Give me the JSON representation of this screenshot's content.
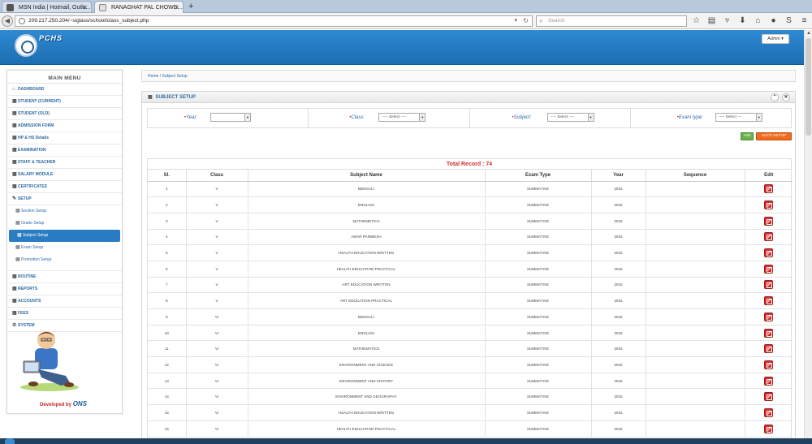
{
  "browser": {
    "tabs": [
      {
        "title": "MSN India | Hotmail, Outlo..."
      },
      {
        "title": "RANAGHAT PAL CHOWD..."
      }
    ],
    "new_tab": "+",
    "url": "209.217.250.204/~siglass/school/class_subject.php",
    "search_placeholder": "Search"
  },
  "app": {
    "logo_text": "PCHS",
    "admin_label": "Admin ▾"
  },
  "sidebar": {
    "title": "MAIN MENU",
    "items_top": [
      {
        "label": "DASHBOARD",
        "icon": "home-icon"
      },
      {
        "label": "STUDENT (CURRENT)",
        "icon": "grid-icon"
      },
      {
        "label": "STUDENT (OLD)",
        "icon": "grid-icon"
      },
      {
        "label": "ADMISSION FORM",
        "icon": "grid-icon"
      },
      {
        "label": "HP & HS Details",
        "icon": "grid-icon"
      },
      {
        "label": "EXAMINATION",
        "icon": "grid-icon"
      },
      {
        "label": "STAFF & TEACHER",
        "icon": "grid-icon"
      },
      {
        "label": "SALARY MODULE",
        "icon": "grid-icon"
      },
      {
        "label": "CERTIFICATES",
        "icon": "grid-icon"
      },
      {
        "label": "SETUP",
        "icon": "wrench-icon"
      }
    ],
    "sub_items": [
      {
        "label": "Section Setup"
      },
      {
        "label": "Grade Setup"
      },
      {
        "label": "Subject Setup"
      },
      {
        "label": "Exam Setup"
      },
      {
        "label": "Promotion Setup"
      }
    ],
    "items_bottom": [
      {
        "label": "ROUTINE",
        "icon": "grid-icon"
      },
      {
        "label": "REPORTS",
        "icon": "grid-icon"
      },
      {
        "label": "ACCOUNTS",
        "icon": "grid-icon"
      },
      {
        "label": "FEES",
        "icon": "grid-icon"
      },
      {
        "label": "SYSTEM",
        "icon": "gears-icon"
      }
    ],
    "developed_by": "Developed by",
    "developer": "ONS"
  },
  "breadcrumb": {
    "home": "Home",
    "sep": "/",
    "current": "Subject Setup"
  },
  "panel": {
    "title": "SUBJECT SETUP",
    "filters": {
      "year_label": "Year:",
      "year_value": "",
      "class_label": "Class:",
      "class_value": "---- Select ----",
      "subject_label": "Subject:",
      "subject_value": "---- Select ----",
      "exam_label": "Exam type:",
      "exam_value": "---- Select ---"
    },
    "add_label": "Add",
    "auto_label": "AUTO SETUP",
    "total_record": "Total Record : 74",
    "columns": [
      "Sl.",
      "Class",
      "Subject Name",
      "Exam Type",
      "Year",
      "Sequence",
      "Edit"
    ],
    "rows": [
      [
        "1",
        "V",
        "BENGALI",
        "SUMMATIVE",
        "2015",
        ""
      ],
      [
        "2",
        "V",
        "ENGLISH",
        "SUMMATIVE",
        "2015",
        ""
      ],
      [
        "3",
        "V",
        "MATHEMETICS",
        "SUMMATIVE",
        "2015",
        ""
      ],
      [
        "4",
        "V",
        "AMAR PARIBESH",
        "SUMMATIVE",
        "2015",
        ""
      ],
      [
        "5",
        "V",
        "HEALTH EDUCATION WRITTEN",
        "SUMMATIVE",
        "2015",
        ""
      ],
      [
        "6",
        "V",
        "HEALTH EDUCATION PRACTICAL",
        "SUMMATIVE",
        "2015",
        ""
      ],
      [
        "7",
        "V",
        "ART EDUCATION WRITTEN",
        "SUMMATIVE",
        "2015",
        ""
      ],
      [
        "8",
        "V",
        "ART EDUCATION PRACTICAL",
        "SUMMATIVE",
        "2015",
        ""
      ],
      [
        "9",
        "VI",
        "BENGALI",
        "SUMMATIVE",
        "2015",
        ""
      ],
      [
        "10",
        "VI",
        "ENGLISH",
        "SUMMATIVE",
        "2015",
        ""
      ],
      [
        "11",
        "VI",
        "MATHEMATICS",
        "SUMMATIVE",
        "2015",
        ""
      ],
      [
        "12",
        "VI",
        "ENVIRONMENT AND SCIENCE",
        "SUMMATIVE",
        "2015",
        ""
      ],
      [
        "13",
        "VI",
        "ENVIRONMENT AND HISTORY",
        "SUMMATIVE",
        "2015",
        ""
      ],
      [
        "14",
        "VI",
        "ENVIRONMENT AND GEOGRAPHY",
        "SUMMATIVE",
        "2015",
        ""
      ],
      [
        "15",
        "VI",
        "HEALTH EDUCATION WRITTEN",
        "SUMMATIVE",
        "2015",
        ""
      ],
      [
        "16",
        "VI",
        "HEALTH EDUCATION PRACTICAL",
        "SUMMATIVE",
        "2015",
        ""
      ]
    ]
  },
  "colors": {
    "header_blue": "#1d6db1",
    "active_menu": "#2b7dc3",
    "total_red": "#d32f2f",
    "auto_orange": "#f06a1f",
    "add_green": "#6ab04c"
  }
}
